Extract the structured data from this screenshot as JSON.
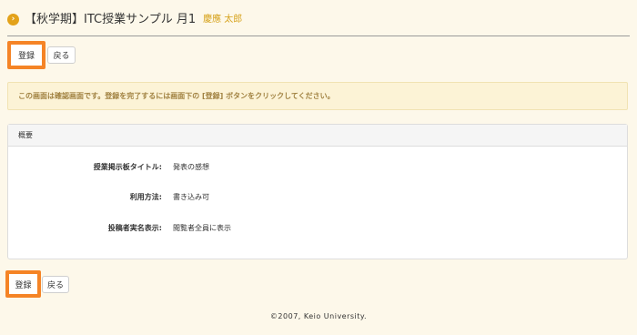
{
  "header": {
    "icon": "chevron-right-circle-icon",
    "title": "【秋学期】ITC授業サンプル 月1",
    "user": "慶應 太郎"
  },
  "top_actions": {
    "register_label": "登録",
    "back_label": "戻る"
  },
  "notice": {
    "text": "この画面は確認画面です。登録を完了するには画面下の [登録] ボタンをクリックしてください。"
  },
  "summary_panel": {
    "heading": "概要",
    "fields": [
      {
        "label": "授業掲示板タイトル:",
        "value": "発表の感想"
      },
      {
        "label": "利用方法:",
        "value": "書き込み可"
      },
      {
        "label": "投稿者実名表示:",
        "value": "閲覧者全員に表示"
      }
    ]
  },
  "bottom_actions": {
    "register_label": "登録",
    "back_label": "戻る"
  },
  "footer": {
    "copyright": "©2007, Keio University."
  },
  "colors": {
    "background": "#fdf8ea",
    "accent_orange": "#f58426",
    "user_name": "#d6a21b",
    "notice_background": "#fcf3d6",
    "notice_text": "#a08140"
  }
}
